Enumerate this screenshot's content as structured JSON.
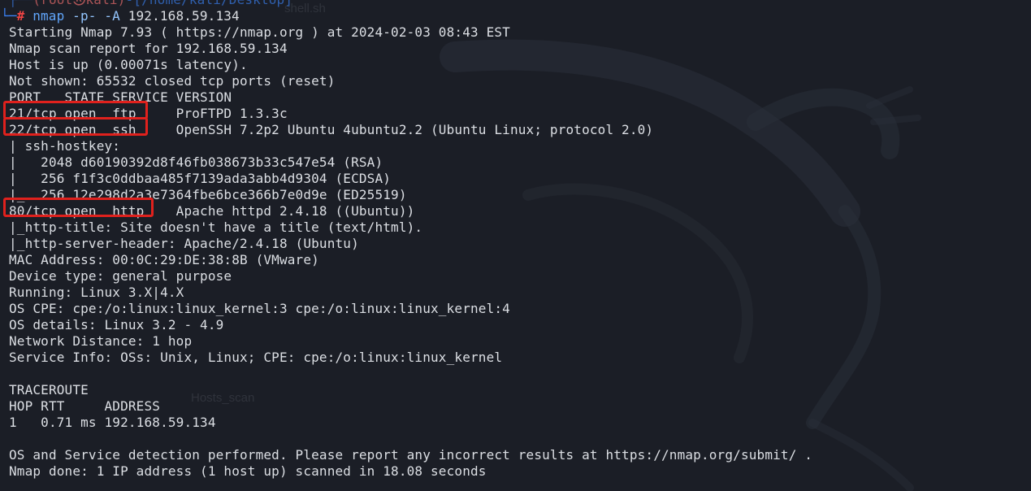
{
  "prompt": {
    "top_user": "(root㉿kali)",
    "top_path": "-[/home/kali/Desktop]",
    "hash": "#",
    "command": "nmap",
    "flags": "-p- -A",
    "target": "192.168.59.134"
  },
  "output_lines": [
    "Starting Nmap 7.93 ( https://nmap.org ) at 2024-02-03 08:43 EST",
    "Nmap scan report for 192.168.59.134",
    "Host is up (0.00071s latency).",
    "Not shown: 65532 closed tcp ports (reset)",
    "PORT   STATE SERVICE VERSION",
    "21/tcp open  ftp     ProFTPD 1.3.3c",
    "22/tcp open  ssh     OpenSSH 7.2p2 Ubuntu 4ubuntu2.2 (Ubuntu Linux; protocol 2.0)",
    "| ssh-hostkey:",
    "|   2048 d60190392d8f46fb038673b33c547e54 (RSA)",
    "|   256 f1f3c0ddbaa485f7139ada3abb4d9304 (ECDSA)",
    "|_  256 12e298d2a3e7364fbe6bce366b7e0d9e (ED25519)",
    "80/tcp open  http    Apache httpd 2.4.18 ((Ubuntu))",
    "|_http-title: Site doesn't have a title (text/html).",
    "|_http-server-header: Apache/2.4.18 (Ubuntu)",
    "MAC Address: 00:0C:29:DE:38:8B (VMware)",
    "Device type: general purpose",
    "Running: Linux 3.X|4.X",
    "OS CPE: cpe:/o:linux:linux_kernel:3 cpe:/o:linux:linux_kernel:4",
    "OS details: Linux 3.2 - 4.9",
    "Network Distance: 1 hop",
    "Service Info: OSs: Unix, Linux; CPE: cpe:/o:linux:linux_kernel",
    "",
    "TRACEROUTE",
    "HOP RTT     ADDRESS",
    "1   0.71 ms 192.168.59.134",
    "",
    "OS and Service detection performed. Please report any incorrect results at https://nmap.org/submit/ .",
    "Nmap done: 1 IP address (1 host up) scanned in 18.08 seconds"
  ],
  "highlights": [
    {
      "label": "21/tcp open ftp"
    },
    {
      "label": "22/tcp open ssh"
    },
    {
      "label": "80/tcp open http"
    }
  ],
  "desktop_ghost": {
    "shell_label": "shell.sh",
    "hosts_label": "Hosts_scan"
  },
  "colors": {
    "background": "#1b1e26",
    "text": "#dcdfe4",
    "highlight_border": "#e0211d",
    "prompt_hash": "#ef4444",
    "command": "#60a5fa"
  }
}
